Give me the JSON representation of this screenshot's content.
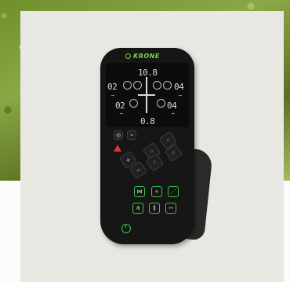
{
  "brand": {
    "logo_text": "KRONE"
  },
  "display": {
    "top_value": "10.8",
    "bottom_value": "0.8",
    "left_upper": "02",
    "right_upper": "04",
    "left_lower": "02",
    "right_lower": "04",
    "tilde": "~"
  },
  "colors": {
    "accent_green": "#3cc24a",
    "logo_green": "#7dd14a",
    "warning_red": "#e4313a"
  },
  "icons": [
    "camera-icon",
    "rake-icon",
    "warning-icon",
    "plus-icon",
    "minus-icon",
    "rotor-up-icon",
    "rotor-down-icon",
    "power-icon"
  ]
}
